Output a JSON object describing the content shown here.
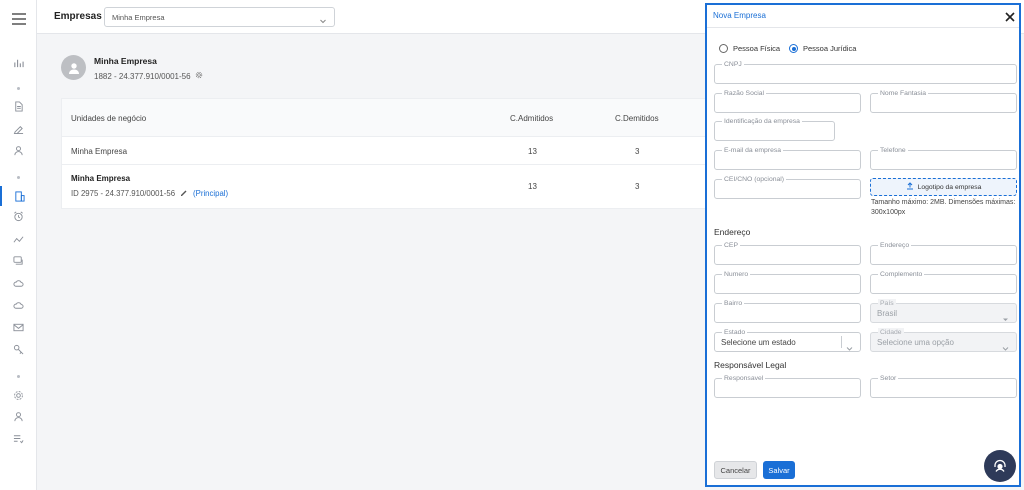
{
  "header": {
    "title": "Empresas",
    "company_select": "Minha Empresa"
  },
  "profile": {
    "name": "Minha Empresa",
    "id_line": "1882 - 24.377.910/0001-56"
  },
  "table": {
    "columns": [
      "Unidades de negócio",
      "C.Admitidos",
      "C.Demitidos"
    ],
    "rows": [
      {
        "name": "Minha Empresa",
        "admitidos": "13",
        "demitidos": "3"
      },
      {
        "name": "Minha Empresa",
        "sub": "ID 2975 - 24.377.910/0001-56",
        "tag": "(Principal)",
        "admitidos": "13",
        "demitidos": "3"
      }
    ]
  },
  "drawer": {
    "title": "Nova Empresa",
    "radio_pf": "Pessoa Física",
    "radio_pj": "Pessoa Jurídica",
    "fields": {
      "cnpj": "CNPJ",
      "razao_social": "Razão Social",
      "nome_fantasia": "Nome Fantasia",
      "identificacao": "Identificação da empresa",
      "email": "E-mail da empresa",
      "telefone": "Telefone",
      "cei": "CEI/CNO (opcional)",
      "cep": "CEP",
      "endereco": "Endereço",
      "numero": "Numero",
      "complemento": "Complemento",
      "bairro": "Bairro",
      "pais": "País",
      "pais_value": "Brasil",
      "estado": "Estado",
      "estado_value": "Selecione um estado",
      "cidade": "Cidade",
      "cidade_value": "Selecione uma opção",
      "responsavel": "Responsavel",
      "setor": "Setor"
    },
    "logo_button": "Logotipo da empresa",
    "logo_hint": "Tamanho máximo: 2MB. Dimensões máximas: 300x100px",
    "section_endereco": "Endereço",
    "section_responsavel": "Responsável Legal",
    "cancel": "Cancelar",
    "save": "Salvar"
  },
  "colors": {
    "accent": "#1a6fd6",
    "support_button": "#2e3a59"
  }
}
